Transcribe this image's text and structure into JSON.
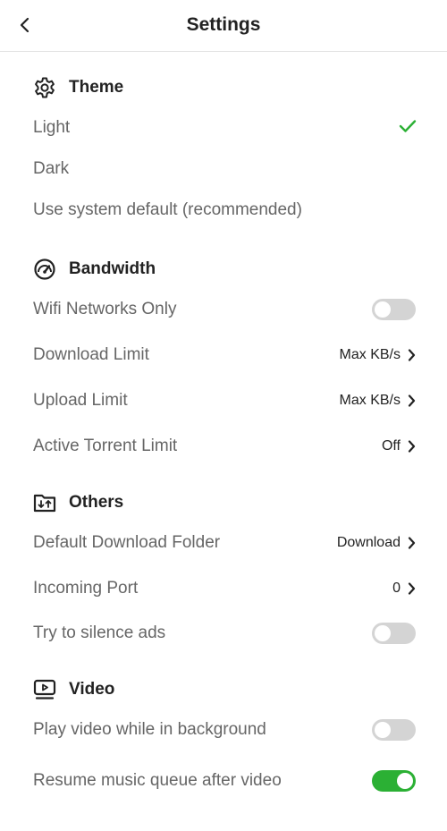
{
  "header": {
    "title": "Settings"
  },
  "theme": {
    "title": "Theme",
    "options": [
      {
        "label": "Light",
        "selected": true
      },
      {
        "label": "Dark",
        "selected": false
      },
      {
        "label": "Use system default (recommended)",
        "selected": false
      }
    ]
  },
  "bandwidth": {
    "title": "Bandwidth",
    "wifi_only": {
      "label": "Wifi Networks Only",
      "on": false
    },
    "download_limit": {
      "label": "Download Limit",
      "value": "Max KB/s"
    },
    "upload_limit": {
      "label": "Upload Limit",
      "value": "Max KB/s"
    },
    "active_torrent_limit": {
      "label": "Active Torrent Limit",
      "value": "Off"
    }
  },
  "others": {
    "title": "Others",
    "default_folder": {
      "label": "Default Download Folder",
      "value": "Download"
    },
    "incoming_port": {
      "label": "Incoming Port",
      "value": "0"
    },
    "silence_ads": {
      "label": "Try to silence ads",
      "on": false
    }
  },
  "video": {
    "title": "Video",
    "play_background": {
      "label": "Play video while in background",
      "on": false
    },
    "resume_music": {
      "label": "Resume music queue after video",
      "on": true
    }
  },
  "colors": {
    "accent": "#2bb034",
    "toggle_off": "#d4d4d4",
    "label": "#666666",
    "text": "#222222"
  }
}
